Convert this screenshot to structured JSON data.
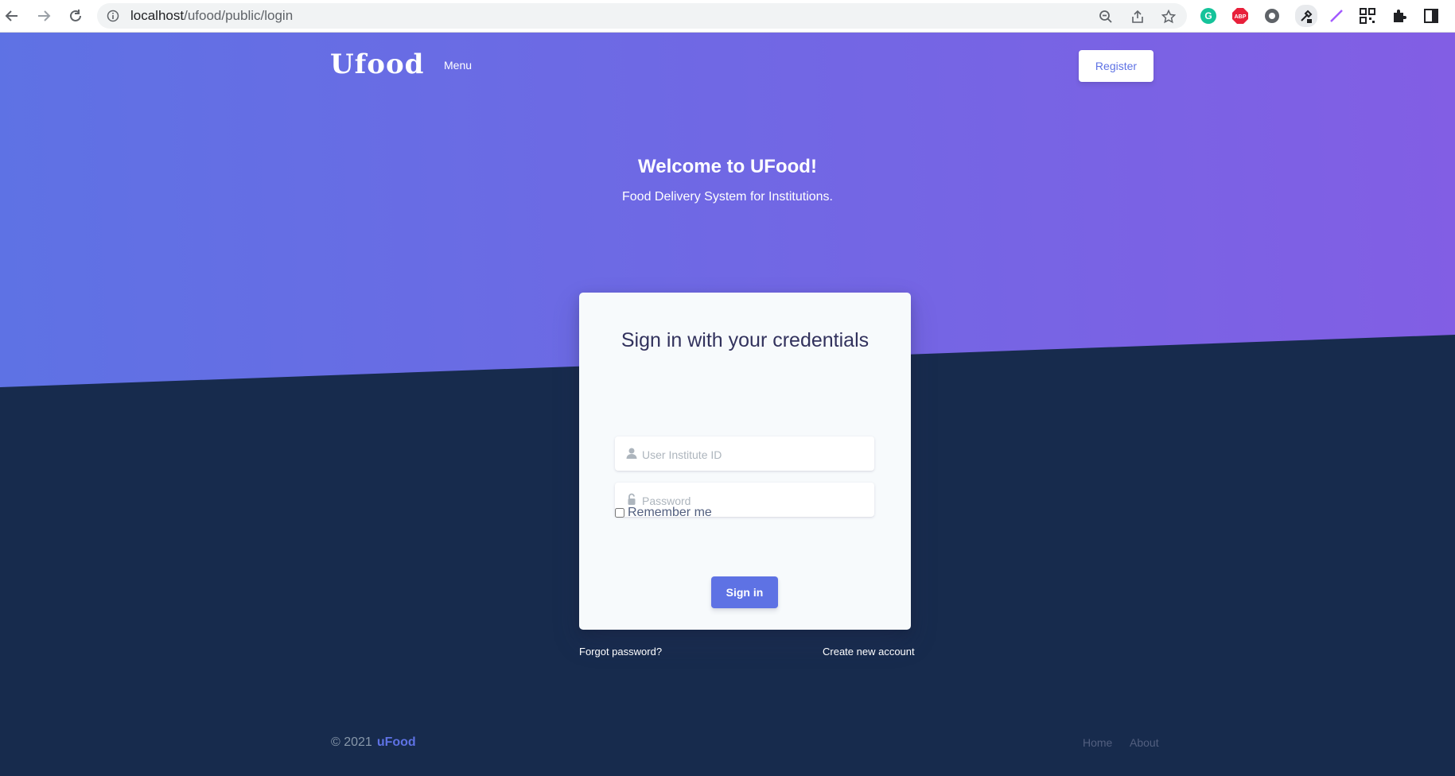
{
  "browser": {
    "url_host": "localhost",
    "url_path": "/ufood/public/login",
    "icons": [
      "back-icon",
      "forward-icon",
      "reload-icon",
      "info-icon",
      "zoom-icon",
      "share-icon",
      "star-icon",
      "grammarly-extension-icon",
      "adblock-extension-icon",
      "extension-icon",
      "eyedropper-extension-icon",
      "pen-extension-icon",
      "qr-extension-icon",
      "puzzle-icon",
      "sidepanel-icon"
    ],
    "adblock_label": "ABP"
  },
  "navbar": {
    "logo": "Ufood",
    "menu_label": "Menu",
    "register_label": "Register"
  },
  "hero": {
    "title": "Welcome to UFood!",
    "subtitle": "Food Delivery System for Institutions."
  },
  "login": {
    "title": "Sign in with your credentials",
    "username_placeholder": "User Institute ID",
    "password_placeholder": "Password",
    "remember_label": "Remember me",
    "remember_checked": false,
    "submit_label": "Sign in"
  },
  "links": {
    "forgot": "Forgot password?",
    "create": "Create new account"
  },
  "footer": {
    "copyright": "© 2021",
    "brand": "uFood",
    "nav": [
      "Home",
      "About"
    ]
  },
  "colors": {
    "gradient_start": "#5e72e4",
    "gradient_end": "#825ee4",
    "dark_bg": "#172b4d",
    "primary": "#5e72e4",
    "card_bg": "#f7fafc"
  }
}
